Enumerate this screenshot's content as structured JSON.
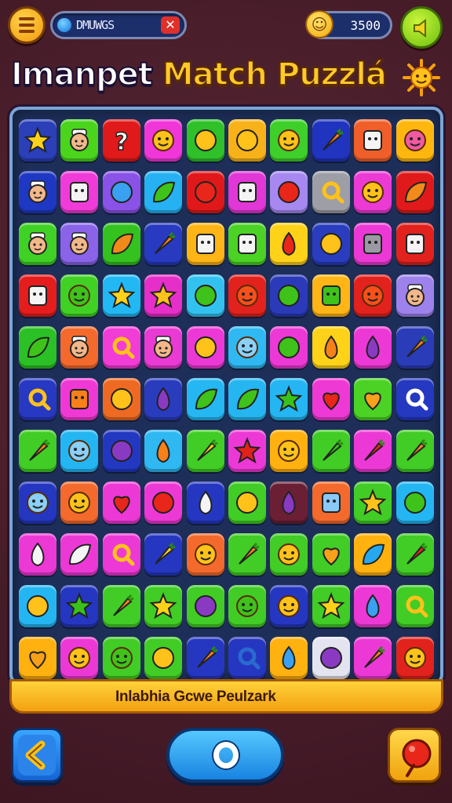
{
  "header": {
    "search_text": "DMUWGS",
    "close_symbol": "✕",
    "coins": "3500"
  },
  "title": {
    "part1": "Imanpet ",
    "part2": "Match Puzzlá"
  },
  "footer": {
    "banner_text": "Inlabhia Gcwe Peulzark"
  },
  "colors": {
    "board_bg": "#1d2e58",
    "board_border": "#7aa6d6",
    "accent_gold": "#ffc928",
    "accent_blue": "#1883e0"
  },
  "board": {
    "rows": [
      [
        [
          "#2a3fb8",
          "sun-face"
        ],
        [
          "#4ad41c",
          "person-white"
        ],
        [
          "#e01a1a",
          "question"
        ],
        [
          "#f036d8",
          "smiley"
        ],
        [
          "#2fc02a",
          "strawberry"
        ],
        [
          "#f7b21a",
          "lemon"
        ],
        [
          "#3ecf2a",
          "smiley"
        ],
        [
          "#2034c0",
          "carrot"
        ],
        [
          "#f05f2a",
          "basket"
        ],
        [
          "#ffb70f",
          "face-pink"
        ]
      ],
      [
        [
          "#1f38c4",
          "person-chef"
        ],
        [
          "#ef3bd7",
          "jar"
        ],
        [
          "#8a52e6",
          "blue-blob"
        ],
        [
          "#26b2f2",
          "leaf-green"
        ],
        [
          "#e0181a",
          "grapes"
        ],
        [
          "#e037d6",
          "crystal"
        ],
        [
          "#a688f0",
          "apple"
        ],
        [
          "#9e9ea6",
          "brown-ring"
        ],
        [
          "#ec3ad4",
          "ghost-face"
        ],
        [
          "#e01a1a",
          "leaf-orange"
        ]
      ],
      [
        [
          "#3fd124",
          "person-chef"
        ],
        [
          "#8a63e8",
          "person-white"
        ],
        [
          "#34c21f",
          "leaf-orange"
        ],
        [
          "#273ac0",
          "carrot"
        ],
        [
          "#ffb515",
          "robot"
        ],
        [
          "#4bd224",
          "box-face"
        ],
        [
          "#ffd21a",
          "red-drop"
        ],
        [
          "#2a3dbf",
          "teal-gem"
        ],
        [
          "#ec38d4",
          "robot-grey"
        ],
        [
          "#e2221d",
          "jar-face"
        ]
      ],
      [
        [
          "#e51d1d",
          "house"
        ],
        [
          "#41d125",
          "green-ghost"
        ],
        [
          "#22b8f4",
          "sun"
        ],
        [
          "#e52fc8",
          "star"
        ],
        [
          "#33c2f0",
          "green-blob"
        ],
        [
          "#e2221d",
          "fire-face"
        ],
        [
          "#2a3ab8",
          "green-lemon"
        ],
        [
          "#ffb515",
          "green-box"
        ],
        [
          "#e2221d",
          "smiley-red"
        ],
        [
          "#9d82ec",
          "person-chef"
        ]
      ],
      [
        [
          "#2bc025",
          "sprout"
        ],
        [
          "#f36a2c",
          "person-chef"
        ],
        [
          "#f23cd6",
          "tag"
        ],
        [
          "#ea3ad4",
          "person-chef"
        ],
        [
          "#ec39d5",
          "banana"
        ],
        [
          "#2fb8f2",
          "blue-face"
        ],
        [
          "#ec39d5",
          "green-lemon"
        ],
        [
          "#ffd21a",
          "fish"
        ],
        [
          "#ec39d5",
          "eggplant"
        ],
        [
          "#2a3cb8",
          "carrot-cone"
        ]
      ],
      [
        [
          "#2738c2",
          "magnifier"
        ],
        [
          "#ef39d4",
          "orange-box"
        ],
        [
          "#ee6a22",
          "orange-swirl"
        ],
        [
          "#2a3cbe",
          "eggplant"
        ],
        [
          "#24b7f2",
          "green-leaf"
        ],
        [
          "#25b6f1",
          "turtle"
        ],
        [
          "#24b5f2",
          "green-star"
        ],
        [
          "#ef39d4",
          "red-heart"
        ],
        [
          "#4bd224",
          "orange-heart"
        ],
        [
          "#2438c0",
          "magnifier-white"
        ]
      ],
      [
        [
          "#41cc26",
          "chili"
        ],
        [
          "#24b6f2",
          "blue-face"
        ],
        [
          "#2338c1",
          "grape-purple"
        ],
        [
          "#2fb8f2",
          "orange-drop"
        ],
        [
          "#41cc26",
          "pepper-yellow"
        ],
        [
          "#ec39d5",
          "red-star"
        ],
        [
          "#ffb10f",
          "orange-face"
        ],
        [
          "#41cc26",
          "green-pepper"
        ],
        [
          "#ec39d5",
          "carrot-red"
        ],
        [
          "#41cc26",
          "pencil"
        ]
      ],
      [
        [
          "#2537c0",
          "cloud-face"
        ],
        [
          "#f36a2c",
          "smiley-orange"
        ],
        [
          "#ec39d5",
          "heart-red"
        ],
        [
          "#ec39d5",
          "tomato"
        ],
        [
          "#2537c0",
          "white-drop"
        ],
        [
          "#41cc26",
          "orange-blob"
        ],
        [
          "#6a1f35",
          "purple-drop"
        ],
        [
          "#f36a2c",
          "blue-crystal"
        ],
        [
          "#41cc26",
          "gold-star"
        ],
        [
          "#24b6f2",
          "green-apple"
        ]
      ],
      [
        [
          "#ec39d5",
          "white-seed"
        ],
        [
          "#ec39d5",
          "white-leaf"
        ],
        [
          "#ec39d5",
          "bow"
        ],
        [
          "#2537c0",
          "carrot-yellow"
        ],
        [
          "#f36a2c",
          "face-orange"
        ],
        [
          "#41cc26",
          "orange-carrot"
        ],
        [
          "#41cc26",
          "yellow-face"
        ],
        [
          "#41cc26",
          "orange-heart"
        ],
        [
          "#ffb10f",
          "blue-leaf"
        ],
        [
          "#41cc26",
          "red-chili"
        ]
      ],
      [
        [
          "#24b6f2",
          "orange-croissant"
        ],
        [
          "#2537c0",
          "green-star"
        ],
        [
          "#41cc26",
          "carrot-orange"
        ],
        [
          "#41cc26",
          "sun"
        ],
        [
          "#41cc26",
          "purple-oval"
        ],
        [
          "#41cc26",
          "green-face"
        ],
        [
          "#2537c0",
          "orange-face"
        ],
        [
          "#41cc26",
          "sun-burst"
        ],
        [
          "#ec39d5",
          "blue-whale"
        ],
        [
          "#41cc26",
          "rainbow-cake"
        ]
      ],
      [
        [
          "#ffb10f",
          "heart-gold"
        ],
        [
          "#ec39d5",
          "smiley-yellow"
        ],
        [
          "#41cc26",
          "green-face"
        ],
        [
          "#41cc26",
          "maraca"
        ],
        [
          "#2537c0",
          "crayon"
        ],
        [
          "#2537c0",
          "magnifier-blue"
        ],
        [
          "#ffb10f",
          "blue-lolly"
        ],
        [
          "#e4e4f0",
          "purple-circle"
        ],
        [
          "#ec39d5",
          "carrot-orange"
        ],
        [
          "#e2221d",
          "face-yellow"
        ]
      ]
    ]
  }
}
